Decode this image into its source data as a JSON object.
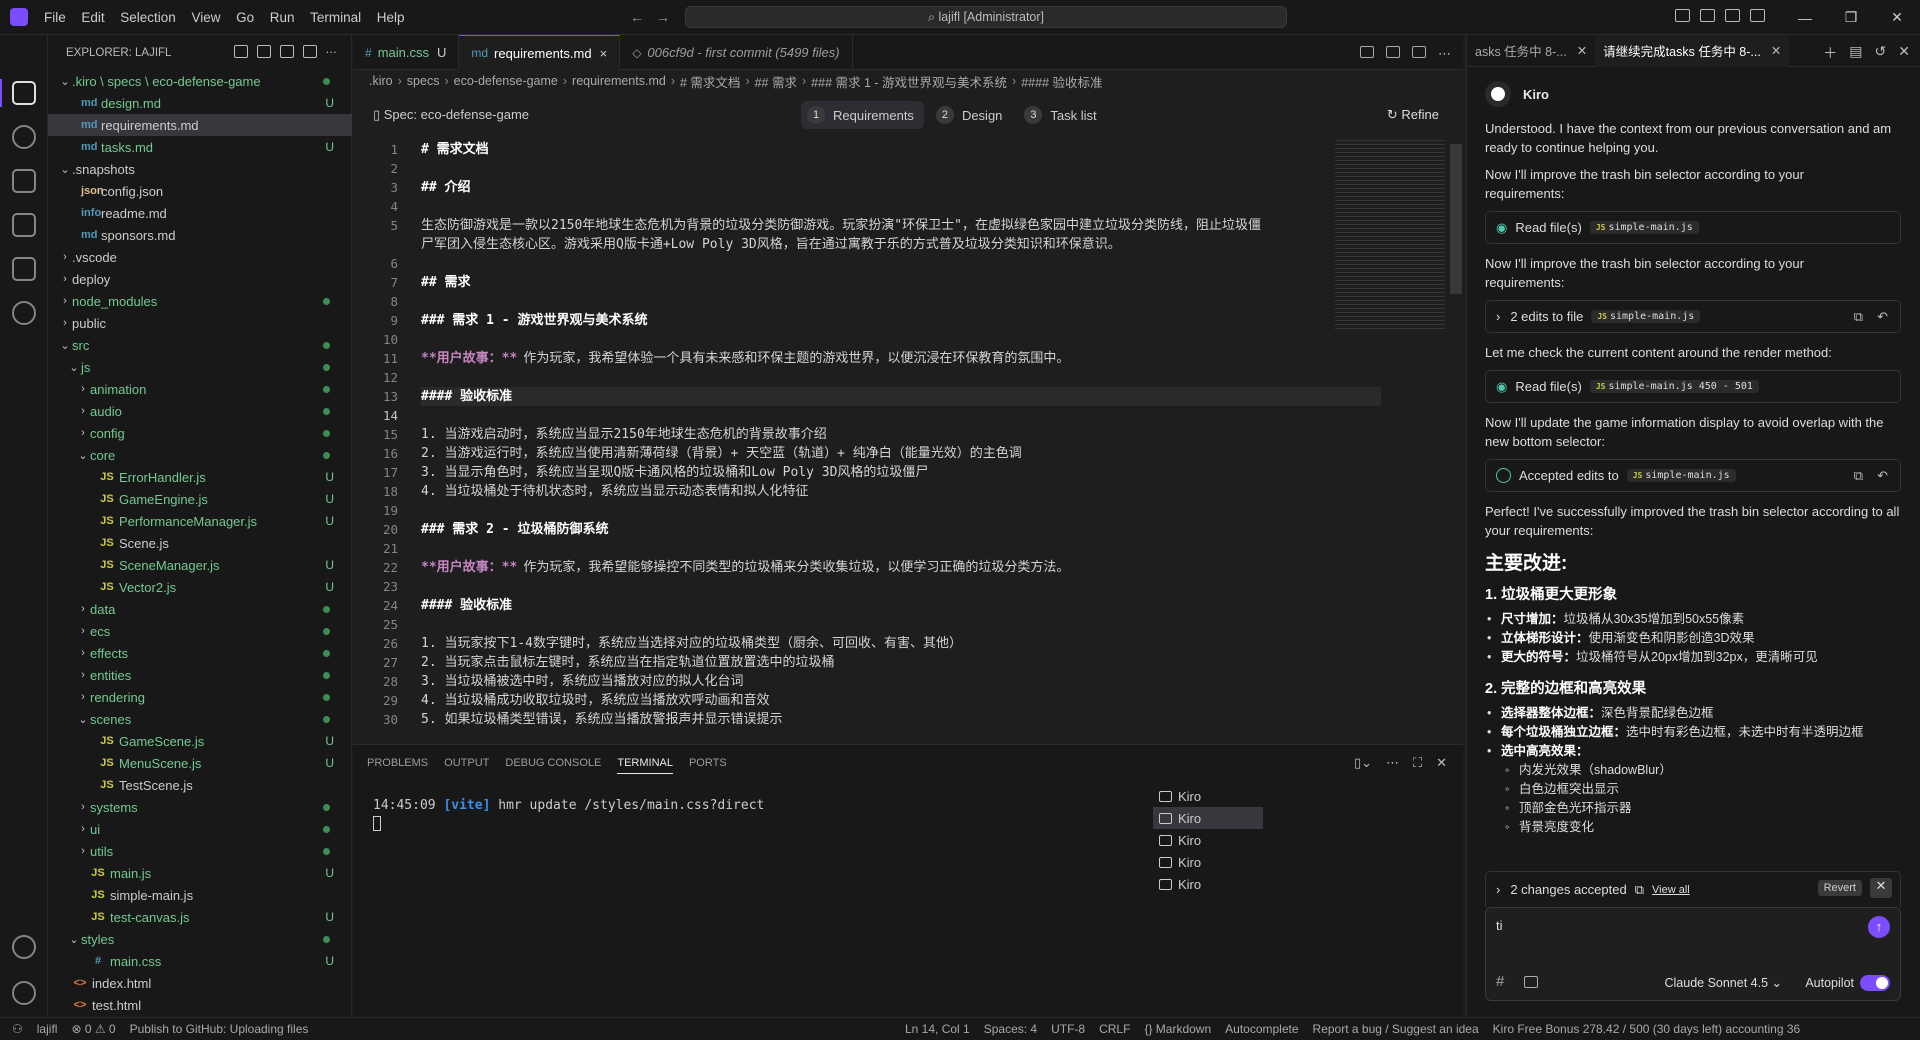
{
  "titlebar": {
    "menu": [
      "File",
      "Edit",
      "Selection",
      "View",
      "Go",
      "Run",
      "Terminal",
      "Help"
    ],
    "command_center": "lajifl [Administrator]"
  },
  "explorer": {
    "title": "EXPLORER: LAJIFL",
    "rows": [
      {
        "indent": 0,
        "chev": "⌄",
        "icon": "",
        "label": ".kiro \\ specs \\ eco-defense-game",
        "status": "dot",
        "color": "c-green"
      },
      {
        "indent": 1,
        "chev": "",
        "icon": "md",
        "label": "design.md",
        "status": "U",
        "color": "c-green"
      },
      {
        "indent": 1,
        "chev": "",
        "icon": "md",
        "label": "requirements.md",
        "status": "",
        "color": "c-gray",
        "selected": true
      },
      {
        "indent": 1,
        "chev": "",
        "icon": "md",
        "label": "tasks.md",
        "status": "U",
        "color": "c-green"
      },
      {
        "indent": 0,
        "chev": "⌄",
        "icon": "",
        "label": ".snapshots",
        "status": "",
        "color": "c-gray"
      },
      {
        "indent": 1,
        "chev": "",
        "icon": "json",
        "label": "config.json",
        "status": "",
        "color": "c-gray"
      },
      {
        "indent": 1,
        "chev": "",
        "icon": "info",
        "label": "readme.md",
        "status": "",
        "color": "c-gray"
      },
      {
        "indent": 1,
        "chev": "",
        "icon": "md",
        "label": "sponsors.md",
        "status": "",
        "color": "c-gray"
      },
      {
        "indent": 0,
        "chev": "›",
        "icon": "",
        "label": ".vscode",
        "status": "",
        "color": "c-gray"
      },
      {
        "indent": 0,
        "chev": "›",
        "icon": "",
        "label": "deploy",
        "status": "",
        "color": "c-gray"
      },
      {
        "indent": 0,
        "chev": "›",
        "icon": "",
        "label": "node_modules",
        "status": "dot",
        "color": "c-green"
      },
      {
        "indent": 0,
        "chev": "›",
        "icon": "",
        "label": "public",
        "status": "",
        "color": "c-gray"
      },
      {
        "indent": 0,
        "chev": "⌄",
        "icon": "",
        "label": "src",
        "status": "dot",
        "color": "c-green"
      },
      {
        "indent": 1,
        "chev": "⌄",
        "icon": "",
        "label": "js",
        "status": "dot",
        "color": "c-green"
      },
      {
        "indent": 2,
        "chev": "›",
        "icon": "",
        "label": "animation",
        "status": "dot",
        "color": "c-green"
      },
      {
        "indent": 2,
        "chev": "›",
        "icon": "",
        "label": "audio",
        "status": "dot",
        "color": "c-green"
      },
      {
        "indent": 2,
        "chev": "›",
        "icon": "",
        "label": "config",
        "status": "dot",
        "color": "c-green"
      },
      {
        "indent": 2,
        "chev": "⌄",
        "icon": "",
        "label": "core",
        "status": "dot",
        "color": "c-green"
      },
      {
        "indent": 3,
        "chev": "",
        "icon": "JS",
        "label": "ErrorHandler.js",
        "status": "U",
        "color": "c-green"
      },
      {
        "indent": 3,
        "chev": "",
        "icon": "JS",
        "label": "GameEngine.js",
        "status": "U",
        "color": "c-green"
      },
      {
        "indent": 3,
        "chev": "",
        "icon": "JS",
        "label": "PerformanceManager.js",
        "status": "U",
        "color": "c-green"
      },
      {
        "indent": 3,
        "chev": "",
        "icon": "JS",
        "label": "Scene.js",
        "status": "",
        "color": "c-gray"
      },
      {
        "indent": 3,
        "chev": "",
        "icon": "JS",
        "label": "SceneManager.js",
        "status": "U",
        "color": "c-green"
      },
      {
        "indent": 3,
        "chev": "",
        "icon": "JS",
        "label": "Vector2.js",
        "status": "U",
        "color": "c-green"
      },
      {
        "indent": 2,
        "chev": "›",
        "icon": "",
        "label": "data",
        "status": "dot",
        "color": "c-green"
      },
      {
        "indent": 2,
        "chev": "›",
        "icon": "",
        "label": "ecs",
        "status": "dot",
        "color": "c-green"
      },
      {
        "indent": 2,
        "chev": "›",
        "icon": "",
        "label": "effects",
        "status": "dot",
        "color": "c-green"
      },
      {
        "indent": 2,
        "chev": "›",
        "icon": "",
        "label": "entities",
        "status": "dot",
        "color": "c-green"
      },
      {
        "indent": 2,
        "chev": "›",
        "icon": "",
        "label": "rendering",
        "status": "dot",
        "color": "c-green"
      },
      {
        "indent": 2,
        "chev": "⌄",
        "icon": "",
        "label": "scenes",
        "status": "dot",
        "color": "c-green"
      },
      {
        "indent": 3,
        "chev": "",
        "icon": "JS",
        "label": "GameScene.js",
        "status": "U",
        "color": "c-green"
      },
      {
        "indent": 3,
        "chev": "",
        "icon": "JS",
        "label": "MenuScene.js",
        "status": "U",
        "color": "c-green"
      },
      {
        "indent": 3,
        "chev": "",
        "icon": "JS",
        "label": "TestScene.js",
        "status": "",
        "color": "c-gray"
      },
      {
        "indent": 2,
        "chev": "›",
        "icon": "",
        "label": "systems",
        "status": "dot",
        "color": "c-green"
      },
      {
        "indent": 2,
        "chev": "›",
        "icon": "",
        "label": "ui",
        "status": "dot",
        "color": "c-green"
      },
      {
        "indent": 2,
        "chev": "›",
        "icon": "",
        "label": "utils",
        "status": "dot",
        "color": "c-green"
      },
      {
        "indent": 2,
        "chev": "",
        "icon": "JS",
        "label": "main.js",
        "status": "U",
        "color": "c-green"
      },
      {
        "indent": 2,
        "chev": "",
        "icon": "JS",
        "label": "simple-main.js",
        "status": "",
        "color": "c-gray"
      },
      {
        "indent": 2,
        "chev": "",
        "icon": "JS",
        "label": "test-canvas.js",
        "status": "U",
        "color": "c-green"
      },
      {
        "indent": 1,
        "chev": "⌄",
        "icon": "",
        "label": "styles",
        "status": "dot",
        "color": "c-green"
      },
      {
        "indent": 2,
        "chev": "",
        "icon": "#",
        "label": "main.css",
        "status": "U",
        "color": "c-green"
      },
      {
        "indent": 0,
        "chev": "",
        "icon": "<>",
        "label": "index.html",
        "status": "",
        "color": "c-gray"
      },
      {
        "indent": 0,
        "chev": "",
        "icon": "<>",
        "label": "test.html",
        "status": "",
        "color": "c-gray"
      }
    ]
  },
  "tabs": [
    {
      "icon": "#",
      "label": "main.css",
      "suffix": "U",
      "active": false
    },
    {
      "icon": "md",
      "label": "requirements.md",
      "suffix": "×",
      "active": true
    },
    {
      "icon": "◇",
      "label": "006cf9d - first commit (5499 files)",
      "suffix": "",
      "active": false,
      "italic": true
    }
  ],
  "breadcrumb": [
    ".kiro",
    "specs",
    "eco-defense-game",
    "requirements.md",
    "# 需求文档",
    "## 需求",
    "### 需求 1 - 游戏世界观与美术系统",
    "#### 验收标准"
  ],
  "specbar": {
    "label": "Spec: eco-defense-game",
    "steps": [
      {
        "num": "1",
        "label": "Requirements",
        "active": true
      },
      {
        "num": "2",
        "label": "Design",
        "active": false
      },
      {
        "num": "3",
        "label": "Task list",
        "active": false
      }
    ],
    "refine": "Refine"
  },
  "editor": {
    "line_numbers": [
      "1",
      "2",
      "3",
      "4",
      "5",
      "",
      "6",
      "7",
      "8",
      "9",
      "10",
      "11",
      "12",
      "13",
      "14",
      "15",
      "16",
      "17",
      "18",
      "19",
      "20",
      "21",
      "22",
      "23",
      "24",
      "25",
      "26",
      "27",
      "28",
      "29",
      "30"
    ],
    "current_line": "14",
    "lines": [
      {
        "t": "# 需求文档",
        "h": true
      },
      {
        "t": ""
      },
      {
        "t": "## 介绍",
        "h": true
      },
      {
        "t": ""
      },
      {
        "t": "生态防御游戏是一款以2150年地球生态危机为背景的垃圾分类防御游戏。玩家扮演\"环保卫士\"，在虚拟绿色家园中建立垃圾分类防线，阻止垃圾僵"
      },
      {
        "t": "尸军团入侵生态核心区。游戏采用Q版卡通+Low Poly 3D风格，旨在通过寓教于乐的方式普及垃圾分类知识和环保意识。"
      },
      {
        "t": ""
      },
      {
        "t": "## 需求",
        "h": true
      },
      {
        "t": ""
      },
      {
        "t": "### 需求 1 - 游戏世界观与美术系统",
        "h": true
      },
      {
        "t": ""
      },
      {
        "t": "作为玩家，我希望体验一个具有未来感和环保主题的游戏世界，以便沉浸在环保教育的氛围中。",
        "us": "**用户故事：**"
      },
      {
        "t": ""
      },
      {
        "t": "#### 验收标准",
        "h": true
      },
      {
        "t": ""
      },
      {
        "t": "1. 当游戏启动时，系统应当显示2150年地球生态危机的背景故事介绍"
      },
      {
        "t": "2. 当游戏运行时，系统应当使用清新薄荷绿（背景）+ 天空蓝（轨道）+ 纯净白（能量光效）的主色调"
      },
      {
        "t": "3. 当显示角色时，系统应当呈现Q版卡通风格的垃圾桶和Low Poly 3D风格的垃圾僵尸"
      },
      {
        "t": "4. 当垃圾桶处于待机状态时，系统应当显示动态表情和拟人化特征"
      },
      {
        "t": ""
      },
      {
        "t": "### 需求 2 - 垃圾桶防御系统",
        "h": true
      },
      {
        "t": ""
      },
      {
        "t": "作为玩家，我希望能够操控不同类型的垃圾桶来分类收集垃圾，以便学习正确的垃圾分类方法。",
        "us": "**用户故事：**"
      },
      {
        "t": ""
      },
      {
        "t": "#### 验收标准",
        "h": true
      },
      {
        "t": ""
      },
      {
        "t": "1. 当玩家按下1-4数字键时，系统应当选择对应的垃圾桶类型（厨余、可回收、有害、其他）"
      },
      {
        "t": "2. 当玩家点击鼠标左键时，系统应当在指定轨道位置放置选中的垃圾桶"
      },
      {
        "t": "3. 当垃圾桶被选中时，系统应当播放对应的拟人化台词"
      },
      {
        "t": "4. 当垃圾桶成功收取垃圾时，系统应当播放欢呼动画和音效"
      },
      {
        "t": "5. 如果垃圾桶类型错误，系统应当播放警报声并显示错误提示"
      }
    ]
  },
  "panel": {
    "tabs": [
      "PROBLEMS",
      "OUTPUT",
      "DEBUG CONSOLE",
      "TERMINAL",
      "PORTS"
    ],
    "active_tab": "TERMINAL",
    "terminal_time": "14:45:09",
    "terminal_tag": "[vite]",
    "terminal_msg": "hmr update /styles/main.css?direct",
    "terminals": [
      "Kiro",
      "Kiro",
      "Kiro",
      "Kiro",
      "Kiro"
    ]
  },
  "chat": {
    "tabs": [
      {
        "label": "asks 任务中 8-...",
        "active": false
      },
      {
        "label": "请继续完成tasks 任务中 8-...",
        "active": true
      }
    ],
    "agent": "Kiro",
    "msg1": "Understood. I have the context from our previous conversation and am ready to continue helping you.",
    "msg2": "Now I'll improve the trash bin selector according to your requirements:",
    "card1": {
      "label": "Read file(s)",
      "chip": "simple-main.js"
    },
    "msg3": "Now I'll improve the trash bin selector according to your requirements:",
    "card2": {
      "label": "2 edits to file",
      "chip": "simple-main.js"
    },
    "msg4": "Let me check the current content around the render method:",
    "card3": {
      "label": "Read file(s)",
      "chip": "simple-main.js 450 - 501"
    },
    "msg5": "Now I'll update the game information display to avoid overlap with the new bottom selector:",
    "card4": {
      "label": "Accepted edits to",
      "chip": "simple-main.js"
    },
    "msg6": "Perfect! I've successfully improved the trash bin selector according to all your requirements:",
    "h2": "主要改进:",
    "sec1": "1. 垃圾桶更大更形象",
    "sec1_items": [
      {
        "b": "尺寸增加：",
        "t": "垃圾桶从30x35增加到50x55像素"
      },
      {
        "b": "立体梯形设计：",
        "t": "使用渐变色和阴影创造3D效果"
      },
      {
        "b": "更大的符号：",
        "t": "垃圾桶符号从20px增加到32px，更清晰可见"
      }
    ],
    "sec2": "2. 完整的边框和高亮效果",
    "sec2_items": [
      {
        "b": "选择器整体边框：",
        "t": "深色背景配绿色边框"
      },
      {
        "b": "每个垃圾桶独立边框：",
        "t": "选中时有彩色边框，未选中时有半透明边框"
      },
      {
        "b": "选中高亮效果：",
        "t": ""
      }
    ],
    "sec2_sub": [
      "内发光效果（shadowBlur）",
      "白色边框突出显示",
      "顶部金色光环指示器",
      "背景亮度变化"
    ],
    "changes": "2 changes accepted",
    "view_all": "View all",
    "revert": "Revert",
    "input_value": "ti",
    "model": "Claude Sonnet 4.5",
    "autopilot": "Autopilot"
  },
  "statusbar": {
    "left": [
      "lajifl",
      "⊗ 0 ⚠ 0",
      "Publish to GitHub: Uploading files"
    ],
    "right": [
      "Ln 14, Col 1",
      "Spaces: 4",
      "UTF-8",
      "CRLF",
      "{} Markdown",
      "Autocomplete",
      "Report a bug / Suggest an idea",
      "Kiro Free Bonus 278.42 / 500 (30 days left) accounting 36"
    ]
  },
  "colors": {
    "accent": "#7c4dff",
    "untracked": "#73c991"
  }
}
